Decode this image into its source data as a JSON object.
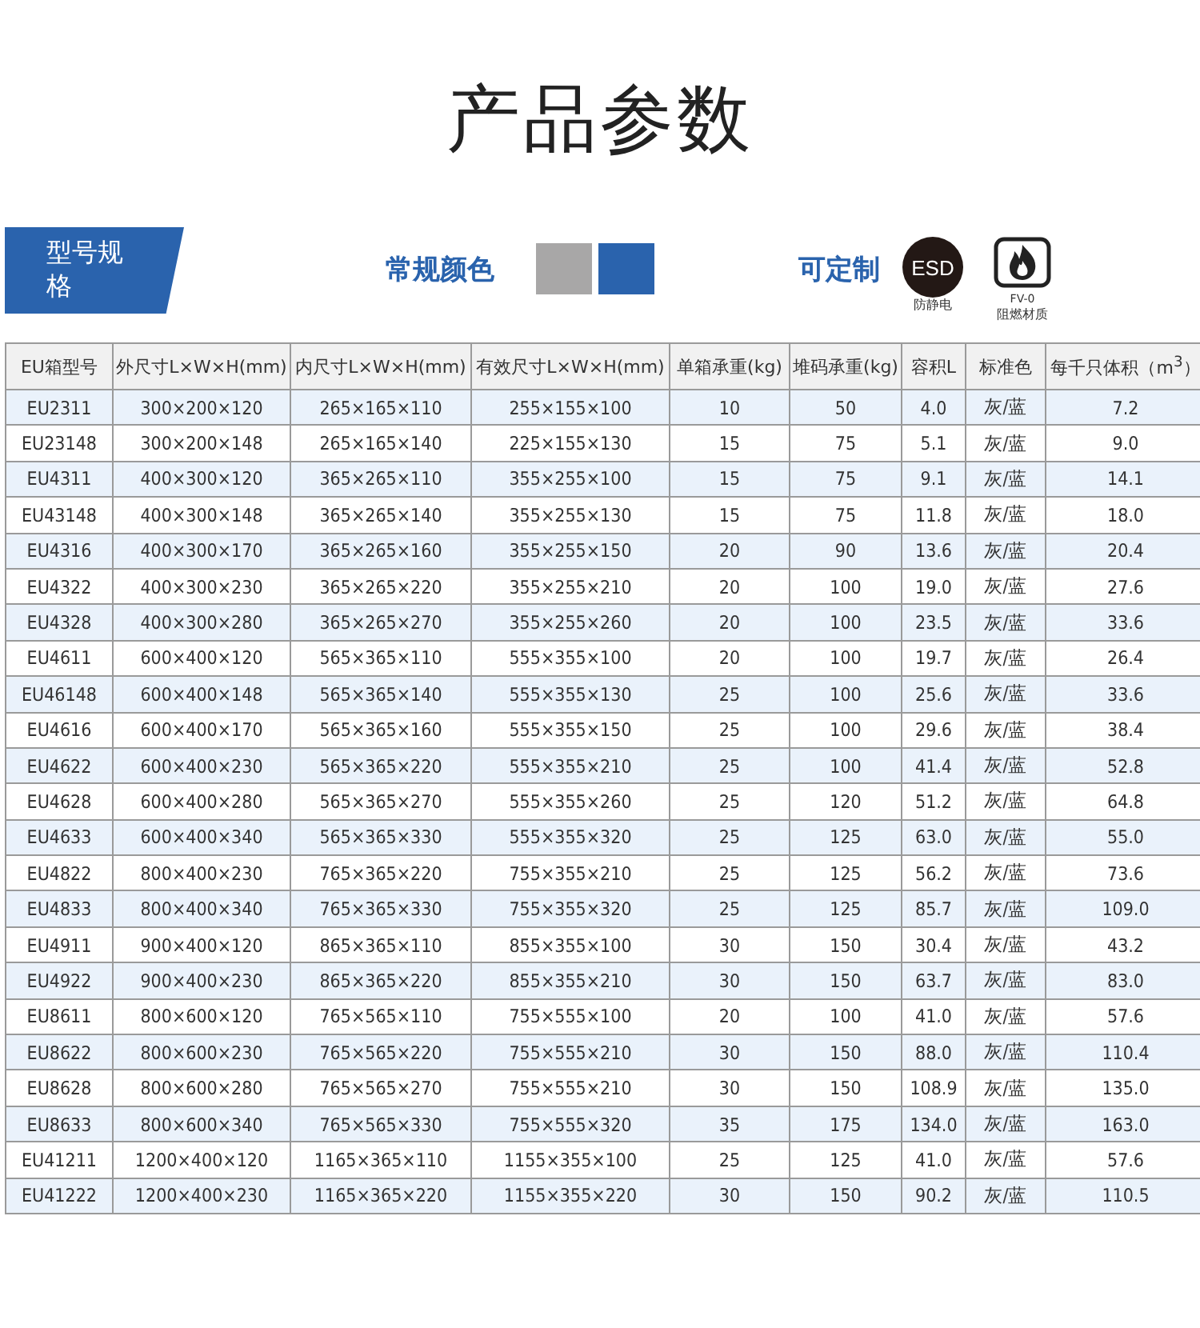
{
  "title": "产品参数",
  "section_tag": "型号规格",
  "colors_label": "常规颜色",
  "colors": [
    {
      "color": "#a8a7a7"
    },
    {
      "color": "#2a63ad"
    }
  ],
  "custom_label": "可定制",
  "badges": [
    {
      "kind": "esd",
      "icon_text": "ESD",
      "caption": "防静电"
    },
    {
      "kind": "fire",
      "caption_top": "FV-0",
      "caption": "阻燃材质"
    }
  ],
  "table": {
    "columns": [
      "EU箱型号",
      "外尺寸L×W×H(mm)",
      "内尺寸L×W×H(mm)",
      "有效尺寸L×W×H(mm)",
      "单箱承重(kg)",
      "堆码承重(kg)",
      "容积L",
      "标准色",
      "每千只体积（m$^{3}$）"
    ],
    "rows": [
      [
        "EU2311",
        "300×200×120",
        "265×165×110",
        "255×155×100",
        "10",
        "50",
        "4.0",
        "灰/蓝",
        "7.2"
      ],
      [
        "EU23148",
        "300×200×148",
        "265×165×140",
        "225×155×130",
        "15",
        "75",
        "5.1",
        "灰/蓝",
        "9.0"
      ],
      [
        "EU4311",
        "400×300×120",
        "365×265×110",
        "355×255×100",
        "15",
        "75",
        "9.1",
        "灰/蓝",
        "14.1"
      ],
      [
        "EU43148",
        "400×300×148",
        "365×265×140",
        "355×255×130",
        "15",
        "75",
        "11.8",
        "灰/蓝",
        "18.0"
      ],
      [
        "EU4316",
        "400×300×170",
        "365×265×160",
        "355×255×150",
        "20",
        "90",
        "13.6",
        "灰/蓝",
        "20.4"
      ],
      [
        "EU4322",
        "400×300×230",
        "365×265×220",
        "355×255×210",
        "20",
        "100",
        "19.0",
        "灰/蓝",
        "27.6"
      ],
      [
        "EU4328",
        "400×300×280",
        "365×265×270",
        "355×255×260",
        "20",
        "100",
        "23.5",
        "灰/蓝",
        "33.6"
      ],
      [
        "EU4611",
        "600×400×120",
        "565×365×110",
        "555×355×100",
        "20",
        "100",
        "19.7",
        "灰/蓝",
        "26.4"
      ],
      [
        "EU46148",
        "600×400×148",
        "565×365×140",
        "555×355×130",
        "25",
        "100",
        "25.6",
        "灰/蓝",
        "33.6"
      ],
      [
        "EU4616",
        "600×400×170",
        "565×365×160",
        "555×355×150",
        "25",
        "100",
        "29.6",
        "灰/蓝",
        "38.4"
      ],
      [
        "EU4622",
        "600×400×230",
        "565×365×220",
        "555×355×210",
        "25",
        "100",
        "41.4",
        "灰/蓝",
        "52.8"
      ],
      [
        "EU4628",
        "600×400×280",
        "565×365×270",
        "555×355×260",
        "25",
        "120",
        "51.2",
        "灰/蓝",
        "64.8"
      ],
      [
        "EU4633",
        "600×400×340",
        "565×365×330",
        "555×355×320",
        "25",
        "125",
        "63.0",
        "灰/蓝",
        "55.0"
      ],
      [
        "EU4822",
        "800×400×230",
        "765×365×220",
        "755×355×210",
        "25",
        "125",
        "56.2",
        "灰/蓝",
        "73.6"
      ],
      [
        "EU4833",
        "800×400×340",
        "765×365×330",
        "755×355×320",
        "25",
        "125",
        "85.7",
        "灰/蓝",
        "109.0"
      ],
      [
        "EU4911",
        "900×400×120",
        "865×365×110",
        "855×355×100",
        "30",
        "150",
        "30.4",
        "灰/蓝",
        "43.2"
      ],
      [
        "EU4922",
        "900×400×230",
        "865×365×220",
        "855×355×210",
        "30",
        "150",
        "63.7",
        "灰/蓝",
        "83.0"
      ],
      [
        "EU8611",
        "800×600×120",
        "765×565×110",
        "755×555×100",
        "20",
        "100",
        "41.0",
        "灰/蓝",
        "57.6"
      ],
      [
        "EU8622",
        "800×600×230",
        "765×565×220",
        "755×555×210",
        "30",
        "150",
        "88.0",
        "灰/蓝",
        "110.4"
      ],
      [
        "EU8628",
        "800×600×280",
        "765×565×270",
        "755×555×210",
        "30",
        "150",
        "108.9",
        "灰/蓝",
        "135.0"
      ],
      [
        "EU8633",
        "800×600×340",
        "765×565×330",
        "755×555×320",
        "35",
        "175",
        "134.0",
        "灰/蓝",
        "163.0"
      ],
      [
        "EU41211",
        "1200×400×120",
        "1165×365×110",
        "1155×355×100",
        "25",
        "125",
        "41.0",
        "灰/蓝",
        "57.6"
      ],
      [
        "EU41222",
        "1200×400×230",
        "1165×365×220",
        "1155×355×220",
        "30",
        "150",
        "90.2",
        "灰/蓝",
        "110.5"
      ]
    ]
  }
}
